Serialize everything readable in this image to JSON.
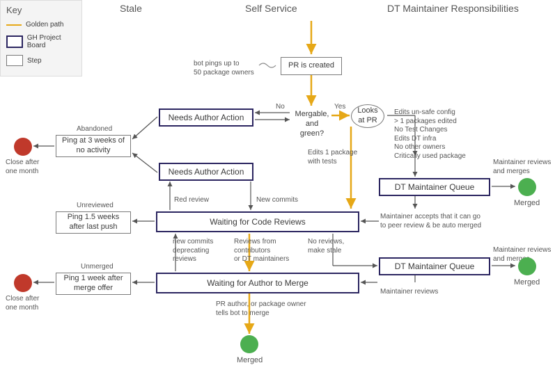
{
  "headers": {
    "key": "Key",
    "stale": "Stale",
    "self_service": "Self Service",
    "dt": "DT Maintainer Responsibilities"
  },
  "key": {
    "golden_path": "Golden path",
    "gh_board": "GH Project Board",
    "step": "Step"
  },
  "nodes": {
    "pr_created": "PR is created",
    "bot_pings": "bot pings up to\n50 package owners",
    "needs_author_1": "Needs Author Action",
    "needs_author_2": "Needs Author Action",
    "mergable": "Mergable,\nand green?",
    "looks_at_pr": "Looks\nat PR",
    "wait_reviews": "Waiting for Code Reviews",
    "wait_merge": "Waiting for Author to Merge",
    "dt_queue_1": "DT Maintainer Queue",
    "dt_queue_2": "DT Maintainer Queue",
    "ping_abandoned": "Ping at 3 weeks\nof no activity",
    "ping_unreviewed": "Ping 1.5 weeks\nafter last push",
    "ping_unmerged": "Ping 1 week\nafter merge offer"
  },
  "labels": {
    "no": "No",
    "yes": "Yes",
    "edits_one_pkg": "Edits 1 package\nwith tests",
    "unsafe_list": "Edits un-safe config\n> 1 packages edited\nNo Test Changes\nEdits DT infra\nNo other owners\nCritically used package",
    "maintainer_reviews_merges_1": "Maintainer reviews\nand merges",
    "maintainer_reviews_merges_2": "Maintainer reviews\nand merges",
    "maintainer_accepts": "Maintainer accepts that it can go\nto peer review & be auto merged",
    "maintainer_reviews": "Maintainer reviews",
    "red_review": "Red review",
    "new_commits": "New commits",
    "new_commits_deprecating": "new commits\ndeprecating\nreviews",
    "reviews_from": "Reviews from\ncontributors\nor DT maintainers",
    "no_reviews_stale": "No reviews,\nmake stale",
    "pr_author_tells": "PR author, or package owner\ntells bot to merge",
    "merged_bottom": "Merged",
    "merged_right_1": "Merged",
    "merged_right_2": "Merged",
    "abandoned": "Abandoned",
    "unreviewed": "Unreviewed",
    "unmerged": "Unmerged",
    "close_after_1": "Close after\none month",
    "close_after_2": "Close after\none month"
  }
}
